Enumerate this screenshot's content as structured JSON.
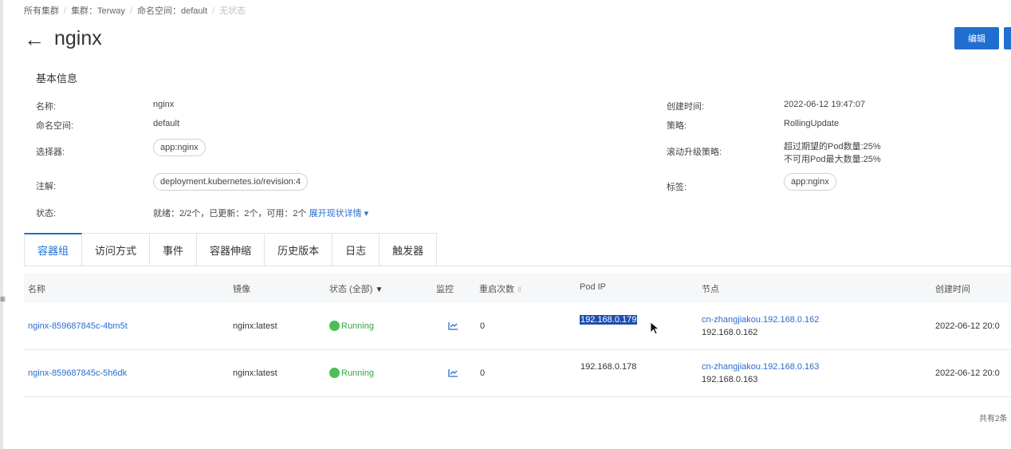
{
  "breadcrumb": {
    "all_clusters": "所有集群",
    "cluster": "集群：Terway",
    "namespace": "命名空间：default",
    "state": "无状态"
  },
  "header": {
    "title": "nginx",
    "edit_label": "编辑"
  },
  "basic_info": {
    "section_title": "基本信息",
    "name_label": "名称:",
    "name_value": "nginx",
    "namespace_label": "命名空间:",
    "namespace_value": "default",
    "selector_label": "选择器:",
    "selector_value": "app:nginx",
    "annotation_label": "注解:",
    "annotation_value": "deployment.kubernetes.io/revision:4",
    "status_label": "状态:",
    "status_value": "就绪：2/2个，已更新：2个，可用：2个",
    "status_link": "展开现状详情",
    "created_label": "创建时间:",
    "created_value": "2022-06-12 19:47:07",
    "strategy_label": "策略:",
    "strategy_value": "RollingUpdate",
    "rolling_label": "滚动升级策略:",
    "rolling_value_1": "超过期望的Pod数量:25%",
    "rolling_value_2": "不可用Pod最大数量:25%",
    "labels_label": "标签:",
    "labels_value": "app:nginx"
  },
  "tabs": [
    "容器组",
    "访问方式",
    "事件",
    "容器伸缩",
    "历史版本",
    "日志",
    "触发器"
  ],
  "table": {
    "headers": {
      "name": "名称",
      "image": "镜像",
      "status": "状态 (全部)",
      "monitor": "监控",
      "restarts": "重启次数",
      "pod_ip": "Pod IP",
      "node": "节点",
      "created": "创建时间"
    },
    "rows": [
      {
        "name": "nginx-859687845c-4bm5t",
        "image": "nginx:latest",
        "status": "Running",
        "restarts": "0",
        "pod_ip": "192.168.0.179",
        "node_name": "cn-zhangjiakou.192.168.0.162",
        "node_ip": "192.168.0.162",
        "created": "2022-06-12 20:0"
      },
      {
        "name": "nginx-859687845c-5h6dk",
        "image": "nginx:latest",
        "status": "Running",
        "restarts": "0",
        "pod_ip": "192.168.0.178",
        "node_name": "cn-zhangjiakou.192.168.0.163",
        "node_ip": "192.168.0.163",
        "created": "2022-06-12 20:0"
      }
    ],
    "footer": "共有2条"
  },
  "icons": {
    "back": "arrow-left-icon",
    "monitor": "chart-icon",
    "sort": "sort-icon",
    "dropdown": "caret-down-icon",
    "cursor": "mouse-cursor-icon"
  },
  "colors": {
    "primary": "#1f6fd0",
    "link": "#2a6ccf",
    "running": "#4bbf57",
    "selection": "#1f4fae"
  }
}
